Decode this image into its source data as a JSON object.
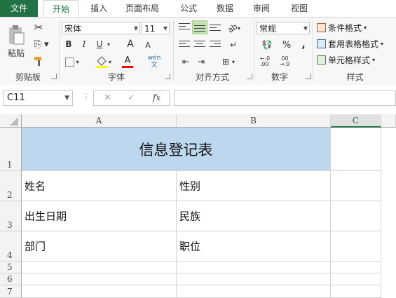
{
  "tabs": [
    "文件",
    "开始",
    "插入",
    "页面布局",
    "公式",
    "数据",
    "审阅",
    "视图"
  ],
  "clipboard": {
    "paste_label": "粘贴",
    "group_label": "剪贴板"
  },
  "font": {
    "name": "宋体",
    "size": "11",
    "bold": "B",
    "italic": "I",
    "underline": "U",
    "grow": "A",
    "shrink": "A",
    "color_a": "A",
    "wen": "wén\n文",
    "group_label": "字体"
  },
  "alignment": {
    "group_label": "对齐方式"
  },
  "number": {
    "format": "常规",
    "percent": "%",
    "comma": ",",
    "group_label": "数字"
  },
  "styles": {
    "conditional": "条件格式",
    "table": "套用表格格式",
    "cell": "单元格样式",
    "group_label": "样式"
  },
  "formula_bar": {
    "name_box": "C11",
    "cancel": "✕",
    "enter": "✓",
    "fx": "fx",
    "value": ""
  },
  "columns": [
    "A",
    "B",
    "C"
  ],
  "rows": [
    "1",
    "2",
    "3",
    "4",
    "5",
    "6",
    "7"
  ],
  "cells": {
    "title": "信息登记表",
    "r2a": "姓名",
    "r2b": "性别",
    "r3a": "出生日期",
    "r3b": "民族",
    "r4a": "部门",
    "r4b": "职位"
  },
  "colors": {
    "accent": "#217346",
    "title_fill": "#bdd7ee"
  }
}
